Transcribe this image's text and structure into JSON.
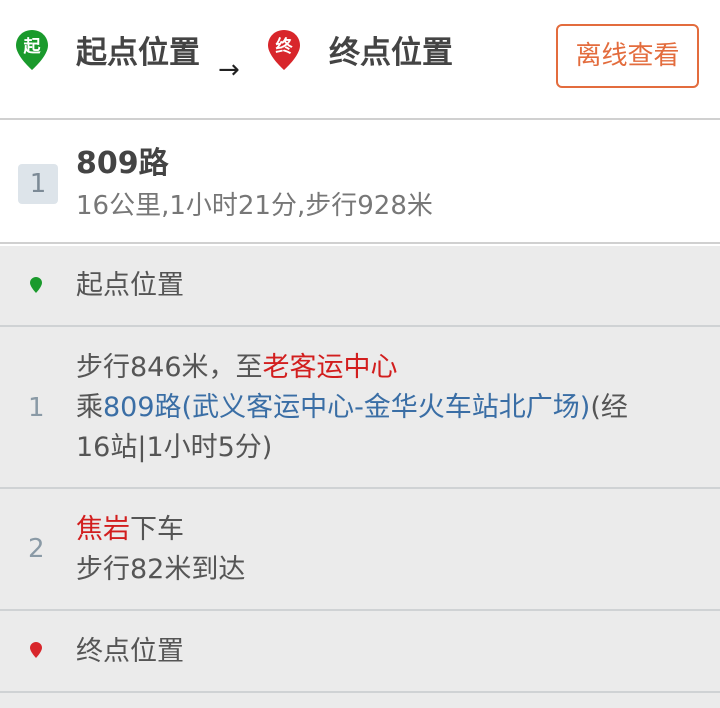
{
  "header": {
    "start_icon_char": "起",
    "start_label": "起点位置",
    "arrow": "→",
    "end_icon_char": "终",
    "end_label": "终点位置",
    "offline_button": "离线查看",
    "colors": {
      "start_pin": "#1a9a2c",
      "end_pin": "#d8262b",
      "button_accent": "#e36c3d"
    }
  },
  "route": {
    "index": "1",
    "name": "809路",
    "meta": "16公里,1小时21分,步行928米"
  },
  "steps": {
    "start": {
      "label": "起点位置",
      "icon": "green-dot-icon"
    },
    "bus": {
      "number": "1",
      "walk_prefix": "步行846米，至",
      "walk_dest": "老客运中心",
      "ride_prefix": "乘",
      "line_link": "809路(武义客运中心-金华火车站北广场)",
      "ride_suffix": "(经",
      "line3": "16站|1小时5分)"
    },
    "alight": {
      "number": "2",
      "stop": "焦岩",
      "stop_suffix": "下车",
      "walk": "步行82米到达"
    },
    "end": {
      "label": "终点位置",
      "icon": "red-dot-icon"
    }
  }
}
